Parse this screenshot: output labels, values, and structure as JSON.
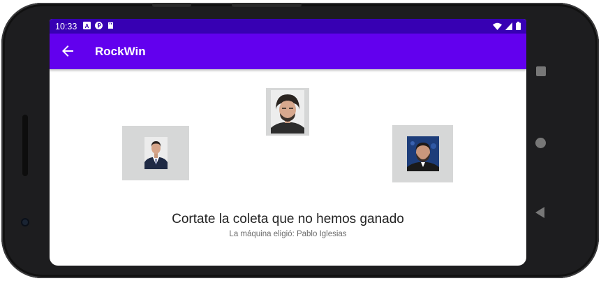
{
  "status_bar": {
    "time": "10:33",
    "left_icons": [
      "a-icon",
      "p-icon",
      "sd-card-icon"
    ],
    "right_icons": [
      "wifi-icon",
      "signal-icon",
      "battery-icon"
    ]
  },
  "app_bar": {
    "title": "RockWin",
    "back_icon": "arrow-left-icon"
  },
  "choices": [
    {
      "name": "choice-left-pedro",
      "icon": "portrait-man-suit"
    },
    {
      "name": "choice-center-pablo",
      "icon": "portrait-man-ponytail"
    },
    {
      "name": "choice-right-santiago",
      "icon": "portrait-man-beard"
    }
  ],
  "result": {
    "title": "Cortate la coleta que no hemos ganado",
    "subtitle": "La máquina eligió: Pablo Iglesias"
  },
  "nav": {
    "overview": "square-icon",
    "home": "circle-icon",
    "back": "triangle-back-icon"
  },
  "colors": {
    "status_bar": "#3700b3",
    "app_bar": "#6200ee",
    "choice_bg": "#d6d7d7",
    "text_primary": "#222222",
    "text_secondary": "#6b6b6b"
  }
}
